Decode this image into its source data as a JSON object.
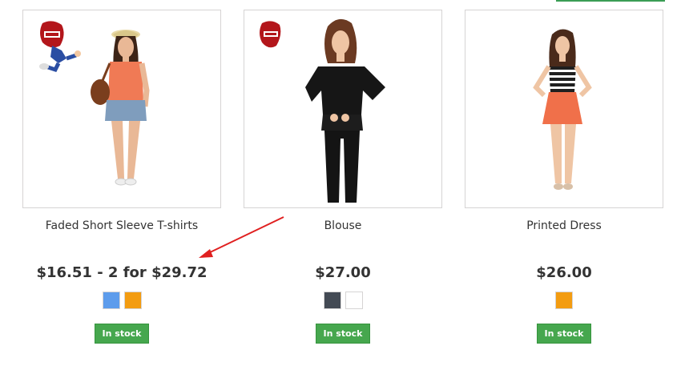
{
  "products": [
    {
      "name": "Faded Short Sleeve T-shirts",
      "price": "$16.51 - 2 for $29.72",
      "colors": [
        "#5d9cec",
        "#f39c11"
      ],
      "stock": "In stock"
    },
    {
      "name": "Blouse",
      "price": "$27.00",
      "colors": [
        "#434a54",
        "#ffffff"
      ],
      "stock": "In stock"
    },
    {
      "name": "Printed Dress",
      "price": "$26.00",
      "colors": [
        "#f39c11"
      ],
      "stock": "In stock"
    }
  ],
  "colors": {
    "badge": "#46a74e",
    "annotation_arrow": "#e02020"
  }
}
